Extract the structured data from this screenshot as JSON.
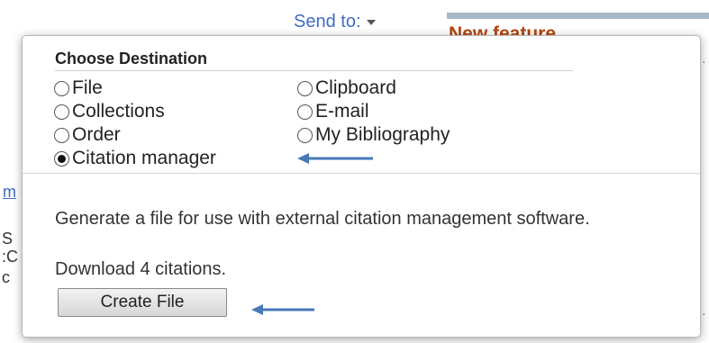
{
  "header": {
    "send_to_label": "Send to:",
    "new_feature_label": "New feature"
  },
  "background_fragments": {
    "link_char": "m",
    "line1": "S",
    "line2": ":C",
    "line3": "c"
  },
  "dialog": {
    "title": "Choose Destination",
    "options": [
      {
        "label": "File",
        "selected": false
      },
      {
        "label": "Clipboard",
        "selected": false
      },
      {
        "label": "Collections",
        "selected": false
      },
      {
        "label": "E-mail",
        "selected": false
      },
      {
        "label": "Order",
        "selected": false
      },
      {
        "label": "My Bibliography",
        "selected": false
      },
      {
        "label": "Citation manager",
        "selected": true
      }
    ],
    "description": "Generate a file for use with external citation management software.",
    "count_text": "Download 4 citations.",
    "button_label": "Create File"
  },
  "colors": {
    "accent_blue": "#3d6cc4",
    "arrow_blue": "#4a78b8",
    "feature_orange": "#b4460e"
  },
  "icons": {
    "dropdown": "chevron-down-icon",
    "annotation": "arrow-left-icon"
  }
}
